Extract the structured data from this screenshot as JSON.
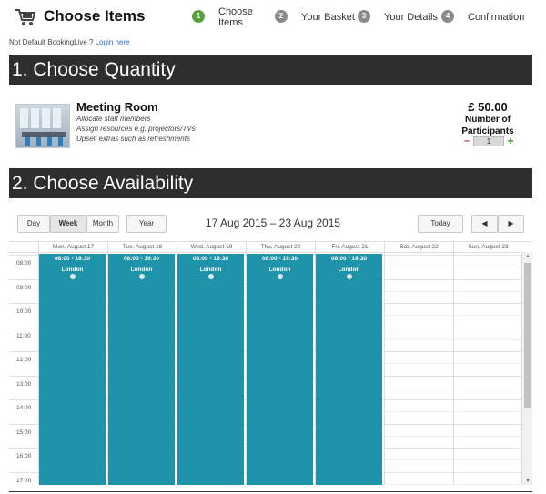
{
  "header": {
    "title": "Choose Items",
    "steps": [
      {
        "number": "1",
        "label": "Choose Items",
        "active": true
      },
      {
        "number": "2",
        "label": "Your Basket",
        "active": false
      },
      {
        "number": "3",
        "label": "Your Details",
        "active": false
      },
      {
        "number": "4",
        "label": "Confirmation",
        "active": false
      }
    ]
  },
  "login": {
    "prefix": "Not Default BookingLive ?",
    "link": "Login here"
  },
  "section1": {
    "title": "1. Choose Quantity"
  },
  "product": {
    "name": "Meeting Room",
    "description": [
      "Allocate staff members",
      "Assign resources e.g. projectors/TVs",
      "Upsell extras such as refreshments"
    ],
    "price": "£ 50.00",
    "participants_label_1": "Number of",
    "participants_label_2": "Participants",
    "quantity": "1",
    "minus": "–",
    "plus": "+"
  },
  "section2": {
    "title": "2. Choose Availability"
  },
  "calendar": {
    "views": {
      "day": "Day",
      "week": "Week",
      "month": "Month",
      "year": "Year"
    },
    "active_view": "week",
    "range_title": "17 Aug 2015 – 23 Aug 2015",
    "today_label": "Today",
    "prev_icon": "◀",
    "next_icon": "▶",
    "days": [
      "Mon, August 17",
      "Tue, August 18",
      "Wed, August 19",
      "Thu, August 20",
      "Fri, August 21",
      "Sat, August 22",
      "Sun, August 23"
    ],
    "hours": [
      "08:00",
      "09:00",
      "10:00",
      "11:00",
      "12:00",
      "13:00",
      "14:00",
      "15:00",
      "16:00",
      "17:00"
    ],
    "events": [
      {
        "day": 0,
        "time": "08:00 - 19:30",
        "location": "London"
      },
      {
        "day": 1,
        "time": "08:00 - 19:30",
        "location": "London"
      },
      {
        "day": 2,
        "time": "08:00 - 19:30",
        "location": "London"
      },
      {
        "day": 3,
        "time": "08:00 - 19:30",
        "location": "London"
      },
      {
        "day": 4,
        "time": "08:00 - 19:30",
        "location": "London"
      }
    ],
    "event_color": "#1f93aa",
    "scroll_up": "▲",
    "scroll_down": "▼"
  }
}
